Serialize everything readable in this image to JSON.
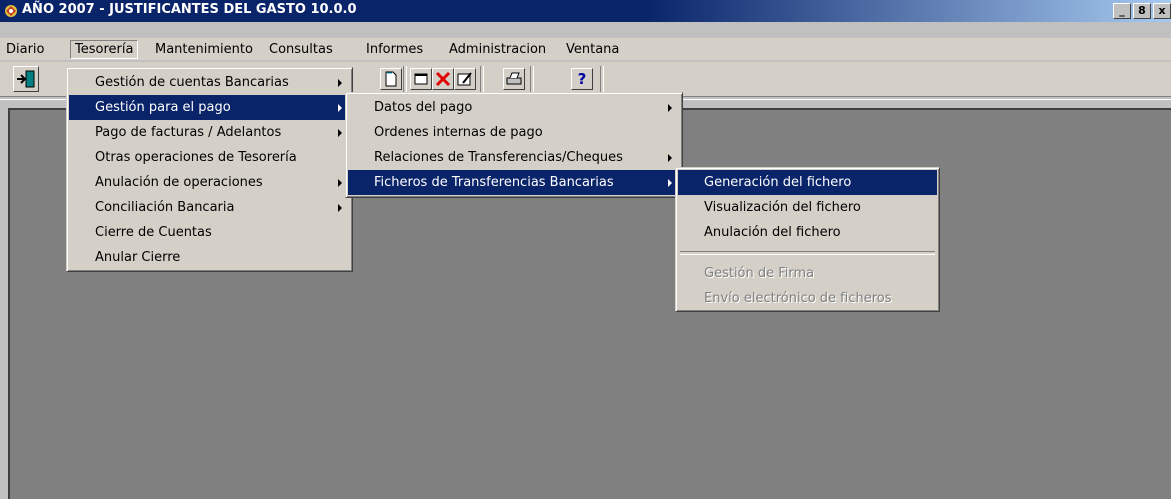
{
  "window": {
    "title": "AÑO 2007 - JUSTIFICANTES DEL GASTO 10.0.0",
    "controls": [
      "_",
      "8",
      "x"
    ]
  },
  "menubar": [
    {
      "label": "Diario"
    },
    {
      "label": "Tesorería"
    },
    {
      "label": "Mantenimiento"
    },
    {
      "label": "Consultas"
    },
    {
      "label": "Informes"
    },
    {
      "label": "Administracion"
    },
    {
      "label": "Ventana"
    }
  ],
  "toolbar": {
    "icons": [
      "exit-icon",
      "new-document-icon",
      "window-icon",
      "delete-icon",
      "edit-icon",
      "print-icon",
      "help-icon"
    ],
    "help_label": "?"
  },
  "menu_tesoreria": {
    "items": [
      {
        "label": "Gestión de cuentas Bancarias"
      },
      {
        "label": "Gestión para el pago"
      },
      {
        "label": "Pago de facturas / Adelantos"
      },
      {
        "label": "Otras operaciones de Tesorería"
      },
      {
        "label": "Anulación de operaciones"
      },
      {
        "label": "Conciliación Bancaria"
      },
      {
        "label": "Cierre de Cuentas"
      },
      {
        "label": "Anular Cierre"
      }
    ]
  },
  "menu_gestion_pago": {
    "items": [
      {
        "label": "Datos del pago"
      },
      {
        "label": "Ordenes internas de pago"
      },
      {
        "label": "Relaciones de Transferencias/Cheques"
      },
      {
        "label": "Ficheros de Transferencias Bancarias"
      }
    ]
  },
  "menu_ficheros": {
    "items": [
      {
        "label": "Generación del fichero"
      },
      {
        "label": "Visualización del fichero"
      },
      {
        "label": "Anulación del fichero"
      },
      {
        "label": "Gestión de Firma"
      },
      {
        "label": "Envío electrónico de ficheros"
      }
    ]
  },
  "colors": {
    "title_bar": "#0a246a",
    "menu_highlight": "#0a246a",
    "workspace": "#808080",
    "chrome": "#d4d0c8"
  }
}
